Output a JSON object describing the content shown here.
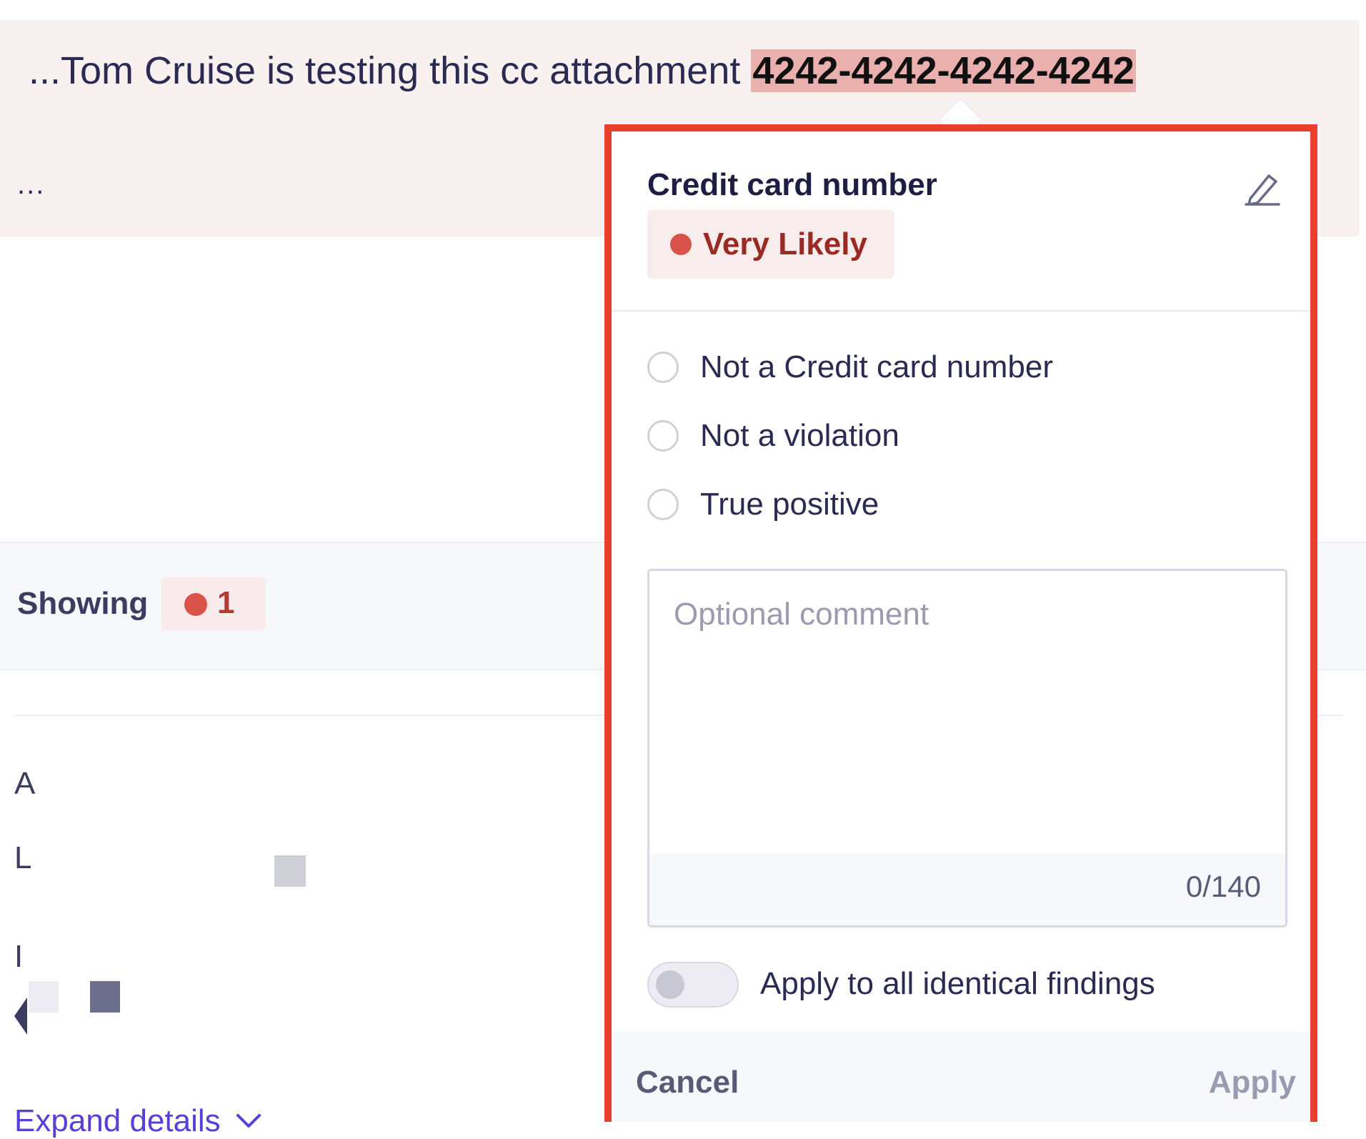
{
  "snippet": {
    "prefix": "...Tom Cruise is testing this cc attachment ",
    "highlighted_value": "4242-4242-4242-4242",
    "ellipsis": "..."
  },
  "showing": {
    "label": "Showing",
    "count": "1"
  },
  "background_fragments": {
    "a": "A",
    "l": "L",
    "i": "I"
  },
  "expand_details": {
    "label": "Expand details",
    "icon": "chevron-down-icon"
  },
  "popover": {
    "title": "Credit card number",
    "edit_icon": "pencil-icon",
    "likelihood": "Very Likely",
    "options": [
      {
        "label": "Not a Credit card number"
      },
      {
        "label": "Not a violation"
      },
      {
        "label": "True positive"
      }
    ],
    "comment": {
      "value": "",
      "placeholder": "Optional comment",
      "char_count": "0/140"
    },
    "apply_all": {
      "label": "Apply to all identical findings",
      "enabled": false
    },
    "cancel_label": "Cancel",
    "apply_label": "Apply"
  },
  "colors": {
    "accent_red": "#d9534a",
    "highlight": "#eab0ae",
    "popover_border": "#e8402c",
    "link": "#5a3fd6"
  }
}
